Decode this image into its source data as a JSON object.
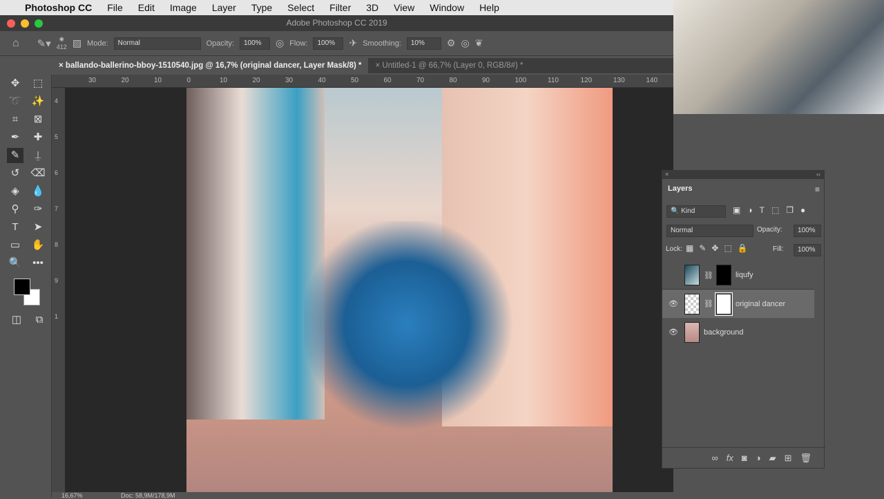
{
  "menubar": {
    "app": "Photoshop CC",
    "items": [
      "File",
      "Edit",
      "Image",
      "Layer",
      "Type",
      "Select",
      "Filter",
      "3D",
      "View",
      "Window",
      "Help"
    ]
  },
  "window": {
    "title": "Adobe Photoshop CC 2019"
  },
  "options": {
    "brush_size": "412",
    "mode_label": "Mode:",
    "mode": "Normal",
    "opacity_label": "Opacity:",
    "opacity": "100%",
    "flow_label": "Flow:",
    "flow": "100%",
    "smoothing_label": "Smoothing:",
    "smoothing": "10%"
  },
  "tabs": [
    {
      "label": "ballando-ballerino-bboy-1510540.jpg @ 16,7% (original dancer, Layer Mask/8) *"
    },
    {
      "label": "Untitled-1 @ 66,7% (Layer 0, RGB/8#) *"
    }
  ],
  "ruler": [
    "30",
    "20",
    "10",
    "0",
    "10",
    "20",
    "30",
    "40",
    "50",
    "60",
    "70",
    "80",
    "90",
    "100",
    "110",
    "120",
    "130",
    "140"
  ],
  "vruler": [
    "4",
    "5",
    "6",
    "7",
    "8",
    "9",
    "1"
  ],
  "status": {
    "zoom": "16,67%",
    "doc": "Doc: 58,9M/178,9M"
  },
  "layers_panel": {
    "title": "Layers",
    "filter": "Kind",
    "blend": "Normal",
    "opacity_label": "Opacity:",
    "opacity": "100%",
    "lock_label": "Lock:",
    "fill_label": "Fill:",
    "fill": "100%",
    "layers": [
      {
        "name": "liqufy",
        "visible": false,
        "mask": "black"
      },
      {
        "name": "original dancer",
        "visible": true,
        "mask": "white",
        "selected": true
      },
      {
        "name": "background",
        "visible": true
      }
    ]
  },
  "colors": {
    "accent_bg": "#535353",
    "canvas": "#282828",
    "foreground": "#000000",
    "background": "#ffffff"
  }
}
